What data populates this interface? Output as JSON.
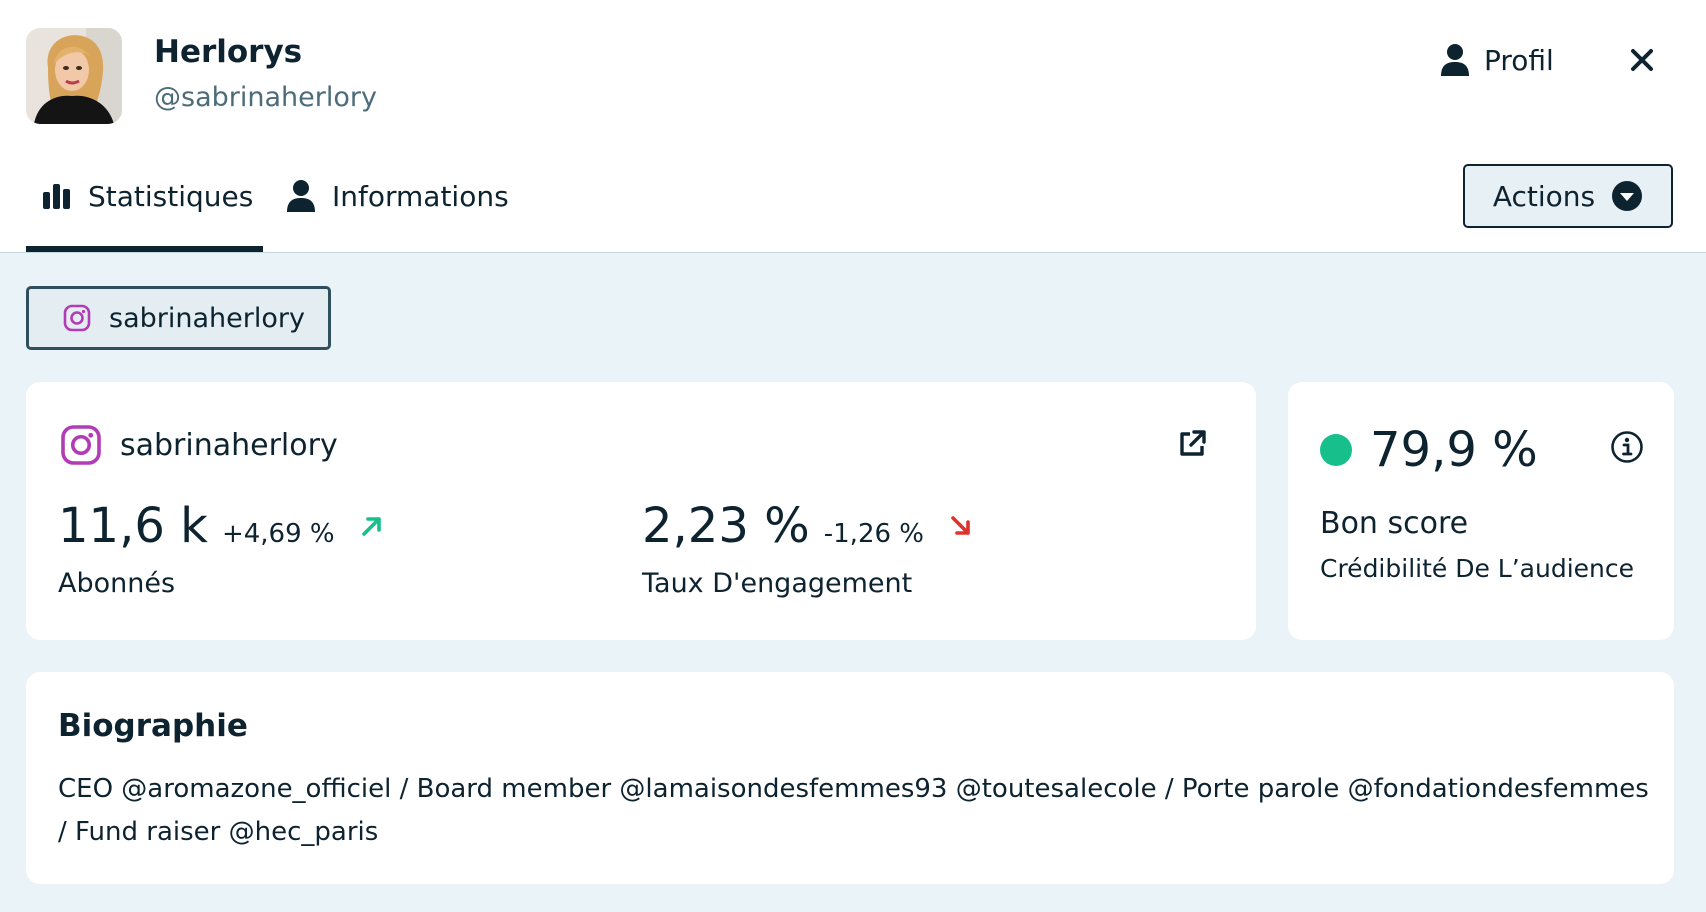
{
  "profile": {
    "name": "Herlorys",
    "handle": "@sabrinaherlory",
    "profil_label": "Profil"
  },
  "tabs": [
    {
      "label": "Statistiques",
      "icon": "bar-chart-icon",
      "active": true
    },
    {
      "label": "Informations",
      "icon": "user-icon",
      "active": false
    }
  ],
  "actions_label": "Actions",
  "account_chip": {
    "label": "sabrinaherlory",
    "icon": "instagram-icon"
  },
  "stats": {
    "account": "sabrinaherlory",
    "followers": {
      "value": "11,6 k",
      "delta": "+4,69 %",
      "trend": "up",
      "label": "Abonnés"
    },
    "engagement": {
      "value": "2,23 %",
      "delta": "-1,26 %",
      "trend": "down",
      "label": "Taux D'engagement"
    }
  },
  "score": {
    "value": "79,9 %",
    "label": "Bon score",
    "sublabel": "Crédibilité De L’audience",
    "color": "#17c08a"
  },
  "bio": {
    "title": "Biographie",
    "text": "CEO @aromazone_officiel / Board member @lamaisondesfemmes93 @toutesalecole / Porte parole @fondationdesfemmes / Fund raiser @hec_paris"
  },
  "colors": {
    "primary": "#0d2330",
    "instagram": "#b23bb6",
    "up": "#17c08a",
    "down": "#e0322d",
    "background": "#eaf3f7"
  }
}
